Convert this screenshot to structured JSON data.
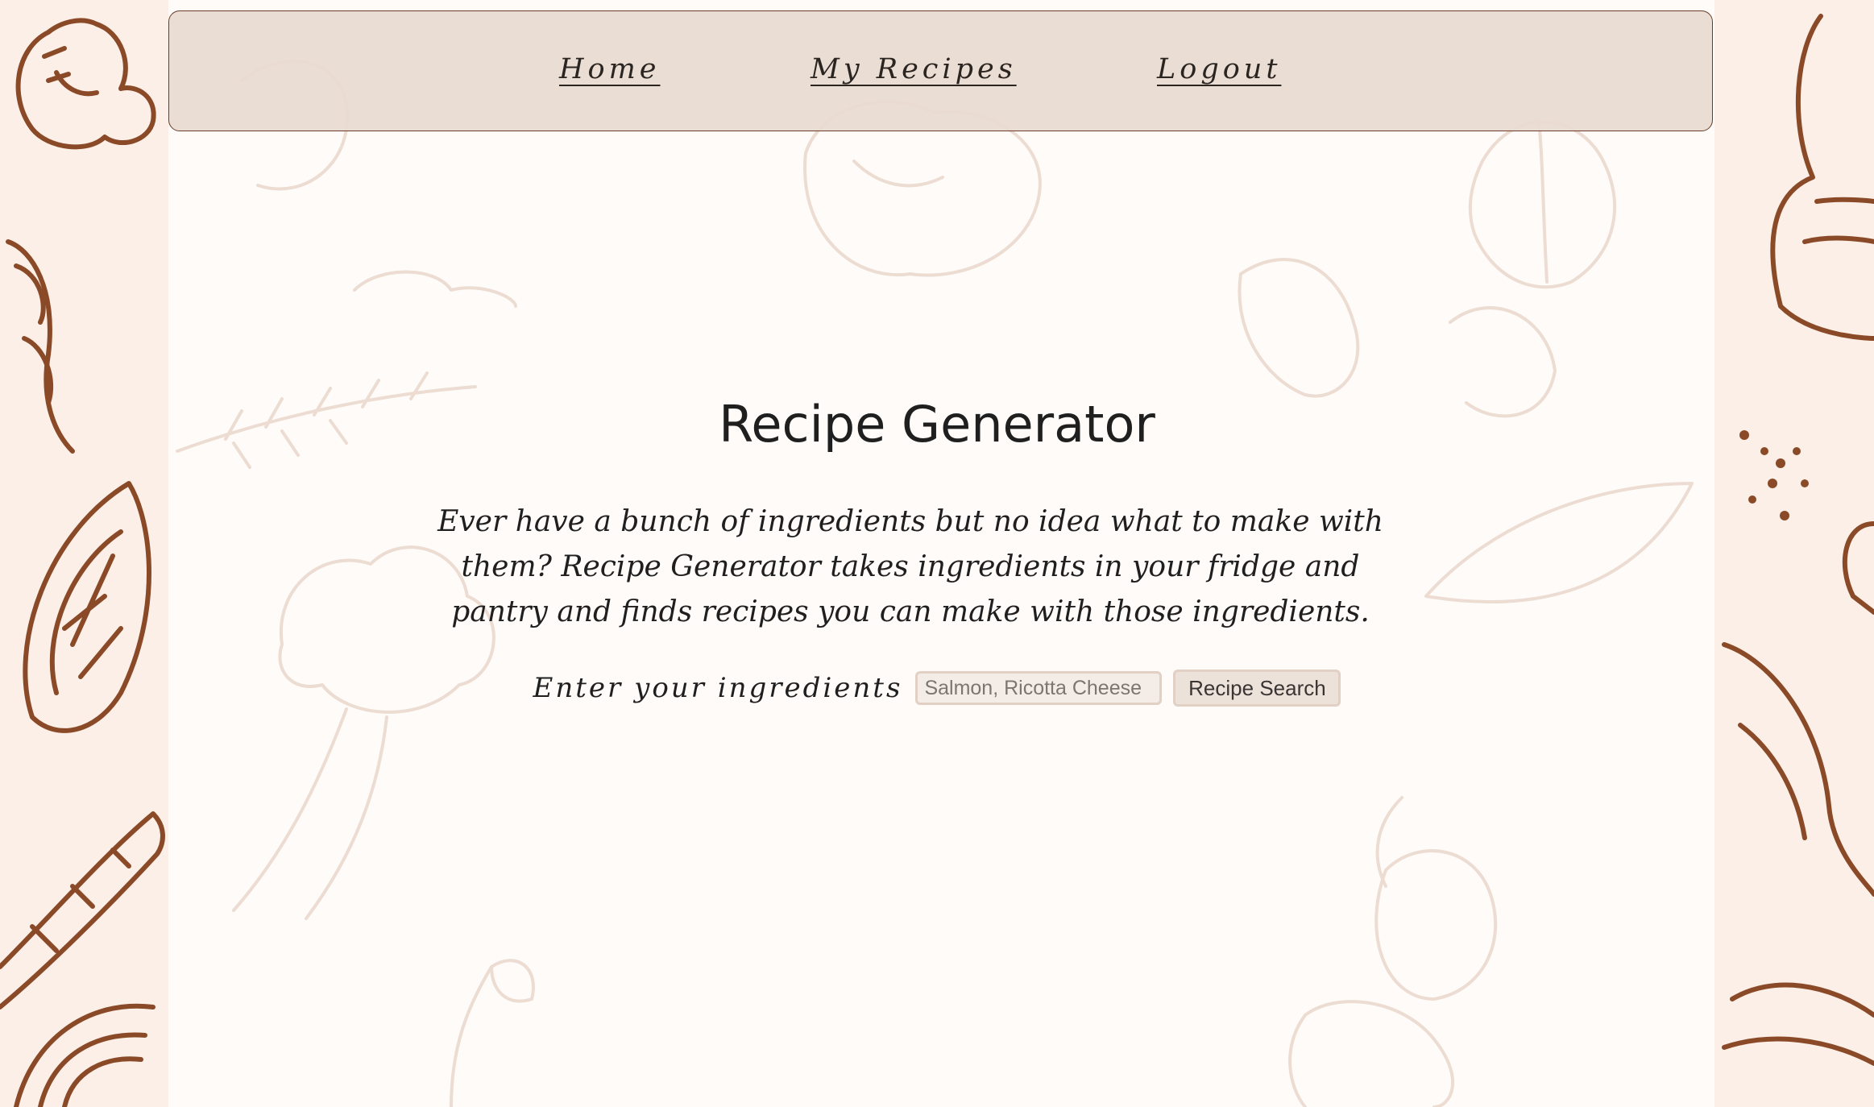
{
  "nav": {
    "home_label": "Home",
    "recipes_label": "My Recipes",
    "logout_label": "Logout"
  },
  "main": {
    "title": "Recipe Generator",
    "description": "Ever have a bunch of ingredients but no idea what to make with them? Recipe Generator takes ingredients in your fridge and pantry and finds recipes you can make with those ingredients."
  },
  "search": {
    "label": "Enter your ingredients",
    "placeholder": "Salmon, Ricotta Cheese",
    "button_label": "Recipe Search"
  },
  "colors": {
    "page_background": "#fbefe8",
    "navbar_background": "#e9dbd0",
    "navbar_border": "#6a3b26",
    "doodle_dark": "#8a4a28",
    "doodle_light": "#ecdcd2"
  }
}
